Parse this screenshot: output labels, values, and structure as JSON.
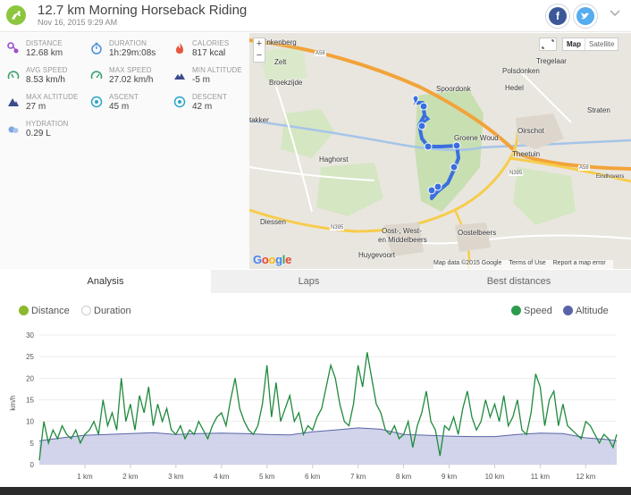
{
  "header": {
    "title": "12.7 km Morning Horseback Riding",
    "subtitle": "Nov 16, 2015 9:29 AM",
    "facebook_icon": "f"
  },
  "stats": [
    {
      "label": "DISTANCE",
      "value": "12.68 km",
      "icon": "distance-icon",
      "color": "#9c4dcc"
    },
    {
      "label": "DURATION",
      "value": "1h:29m:08s",
      "icon": "stopwatch-icon",
      "color": "#4a90d9"
    },
    {
      "label": "CALORIES",
      "value": "817 kcal",
      "icon": "flame-icon",
      "color": "#e8553e"
    },
    {
      "label": "AVG SPEED",
      "value": "8.53 km/h",
      "icon": "speedometer-icon",
      "color": "#3aa06a"
    },
    {
      "label": "MAX SPEED",
      "value": "27.02 km/h",
      "icon": "speedometer-max-icon",
      "color": "#3aa06a"
    },
    {
      "label": "MIN ALTITUDE",
      "value": "-5 m",
      "icon": "mountain-low-icon",
      "color": "#3b4a8c"
    },
    {
      "label": "MAX ALTITUDE",
      "value": "27 m",
      "icon": "mountain-high-icon",
      "color": "#3b4a8c"
    },
    {
      "label": "ASCENT",
      "value": "45 m",
      "icon": "ascent-icon",
      "color": "#2aa4c9"
    },
    {
      "label": "DESCENT",
      "value": "42 m",
      "icon": "descent-icon",
      "color": "#2aa4c9"
    },
    {
      "label": "HYDRATION",
      "value": "0.29 L",
      "icon": "droplets-icon",
      "color": "#7fa6e0"
    }
  ],
  "map": {
    "places": [
      "Enkenberg",
      "Zelt",
      "Broekzijde",
      "Tregelaar",
      "Polsdonken",
      "Spoordonk",
      "Hedel",
      "Straten",
      "Oirschot",
      "Groene Woud",
      "Theetuin",
      "Haghorst",
      "takker",
      "Diessen",
      "Oost-, West-",
      "en Middelbeers",
      "Oostelbeers",
      "Huygevoort",
      "Eindhovens"
    ],
    "roads": [
      "A58",
      "A58",
      "N395",
      "N395"
    ],
    "zoom_in": "+",
    "zoom_out": "−",
    "type_map": "Map",
    "type_satellite": "Satellite",
    "logo": "Google",
    "attribution": [
      "Map data ©2015 Google",
      "Terms of Use",
      "Report a map error"
    ]
  },
  "tabs": [
    "Analysis",
    "Laps",
    "Best distances"
  ],
  "toggles": {
    "distance": "Distance",
    "duration": "Duration",
    "speed": "Speed",
    "altitude": "Altitude"
  },
  "chart_data": {
    "type": "line",
    "ylabel": "km/h",
    "yticks": [
      "0",
      "5",
      "10",
      "15",
      "20",
      "25",
      "30"
    ],
    "ylim": [
      0,
      30
    ],
    "xlim": [
      0,
      12.68
    ],
    "xticks": [
      "1 km",
      "2 km",
      "3 km",
      "4 km",
      "5 km",
      "6 km",
      "7 km",
      "8 km",
      "9 km",
      "10 km",
      "11 km",
      "12 km"
    ],
    "grid": true,
    "series": [
      {
        "name": "Speed",
        "color": "#1e8a3c",
        "x": [
          0,
          0.1,
          0.2,
          0.3,
          0.4,
          0.5,
          0.6,
          0.7,
          0.8,
          0.9,
          1.0,
          1.1,
          1.2,
          1.3,
          1.4,
          1.5,
          1.6,
          1.7,
          1.8,
          1.9,
          2.0,
          2.1,
          2.2,
          2.3,
          2.4,
          2.5,
          2.6,
          2.7,
          2.8,
          2.9,
          3.0,
          3.1,
          3.2,
          3.3,
          3.4,
          3.5,
          3.6,
          3.7,
          3.8,
          3.9,
          4.0,
          4.1,
          4.2,
          4.3,
          4.4,
          4.5,
          4.6,
          4.7,
          4.8,
          4.9,
          5.0,
          5.1,
          5.2,
          5.3,
          5.4,
          5.5,
          5.6,
          5.7,
          5.8,
          5.9,
          6.0,
          6.1,
          6.2,
          6.3,
          6.4,
          6.5,
          6.6,
          6.7,
          6.8,
          6.9,
          7.0,
          7.1,
          7.2,
          7.3,
          7.4,
          7.5,
          7.6,
          7.7,
          7.8,
          7.9,
          8.0,
          8.1,
          8.2,
          8.3,
          8.4,
          8.5,
          8.6,
          8.7,
          8.8,
          8.9,
          9.0,
          9.1,
          9.2,
          9.3,
          9.4,
          9.5,
          9.6,
          9.7,
          9.8,
          9.9,
          10.0,
          10.1,
          10.2,
          10.3,
          10.4,
          10.5,
          10.6,
          10.7,
          10.8,
          10.9,
          11.0,
          11.1,
          11.2,
          11.3,
          11.4,
          11.5,
          11.6,
          11.7,
          11.8,
          11.9,
          12.0,
          12.1,
          12.2,
          12.3,
          12.4,
          12.5,
          12.6,
          12.68
        ],
        "values": [
          1,
          10,
          5,
          8,
          6,
          9,
          7,
          6,
          8,
          5,
          7,
          8,
          10,
          7,
          15,
          9,
          12,
          8,
          20,
          10,
          14,
          8,
          16,
          12,
          18,
          9,
          14,
          10,
          13,
          8,
          7,
          9,
          6,
          8,
          7,
          10,
          8,
          6,
          9,
          11,
          12,
          9,
          15,
          20,
          13,
          10,
          8,
          7,
          9,
          14,
          23,
          11,
          19,
          10,
          13,
          16,
          10,
          12,
          7,
          9,
          8,
          11,
          13,
          18,
          23,
          20,
          14,
          10,
          9,
          14,
          23,
          18,
          26,
          20,
          14,
          12,
          8,
          7,
          9,
          6,
          7,
          10,
          4,
          9,
          12,
          17,
          10,
          8,
          2,
          9,
          8,
          11,
          7,
          13,
          17,
          11,
          8,
          10,
          15,
          11,
          14,
          10,
          16,
          9,
          11,
          15,
          8,
          7,
          12,
          21,
          18,
          9,
          15,
          17,
          9,
          14,
          9,
          8,
          7,
          6,
          10,
          9,
          7,
          5,
          7,
          6,
          4,
          7
        ]
      },
      {
        "name": "Altitude",
        "color": "#5964a8",
        "x": [
          0,
          0.5,
          1.0,
          1.5,
          2.0,
          2.5,
          3.0,
          3.5,
          4.0,
          4.5,
          5.0,
          5.5,
          6.0,
          6.5,
          7.0,
          7.5,
          8.0,
          8.5,
          9.0,
          9.5,
          10.0,
          10.5,
          11.0,
          11.5,
          12.0,
          12.5,
          12.68
        ],
        "values": [
          5.5,
          6.2,
          6.8,
          7.0,
          7.2,
          7.4,
          7.0,
          7.2,
          7.3,
          7.2,
          7.0,
          6.9,
          7.6,
          8.0,
          8.5,
          8.2,
          7.0,
          6.8,
          6.6,
          6.5,
          6.5,
          7.0,
          7.3,
          7.2,
          6.2,
          5.8,
          5.5
        ]
      }
    ]
  }
}
